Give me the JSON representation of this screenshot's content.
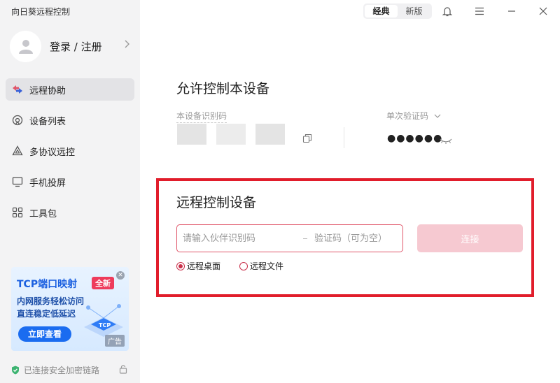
{
  "app": {
    "title": "向日葵远程控制"
  },
  "user": {
    "login_label": "登录 / 注册"
  },
  "nav": [
    {
      "label": "远程协助",
      "icon": "remote-assist-icon",
      "active": true
    },
    {
      "label": "设备列表",
      "icon": "device-list-icon"
    },
    {
      "label": "多协议远控",
      "icon": "multi-protocol-icon"
    },
    {
      "label": "手机投屏",
      "icon": "screen-cast-icon"
    },
    {
      "label": "工具包",
      "icon": "toolkit-icon"
    }
  ],
  "ad": {
    "title": "TCP端口映射",
    "badge": "全新",
    "line1": "内网服务轻松访问",
    "line2": "直连稳定低延迟",
    "button": "立即查看",
    "tag": "广告",
    "graphic_label": "TCP"
  },
  "status": {
    "text": "已连接安全加密链路"
  },
  "topbar": {
    "mode_classic": "经典",
    "mode_new": "新版",
    "active_mode": "经典"
  },
  "allow": {
    "title": "允许控制本设备",
    "device_id_label": "本设备识别码",
    "otp_label": "单次验证码",
    "otp_value": "●●●●●●"
  },
  "remote": {
    "title": "远程控制设备",
    "partner_placeholder": "请输入伙伴识别码",
    "code_placeholder": "验证码（可为空）",
    "connect_label": "连接",
    "option_desktop": "远程桌面",
    "option_file": "远程文件",
    "selected_option": "远程桌面"
  },
  "colors": {
    "accent": "#e0566a",
    "highlight_box": "#e11d2b",
    "connect_disabled": "#f6c9d1"
  }
}
